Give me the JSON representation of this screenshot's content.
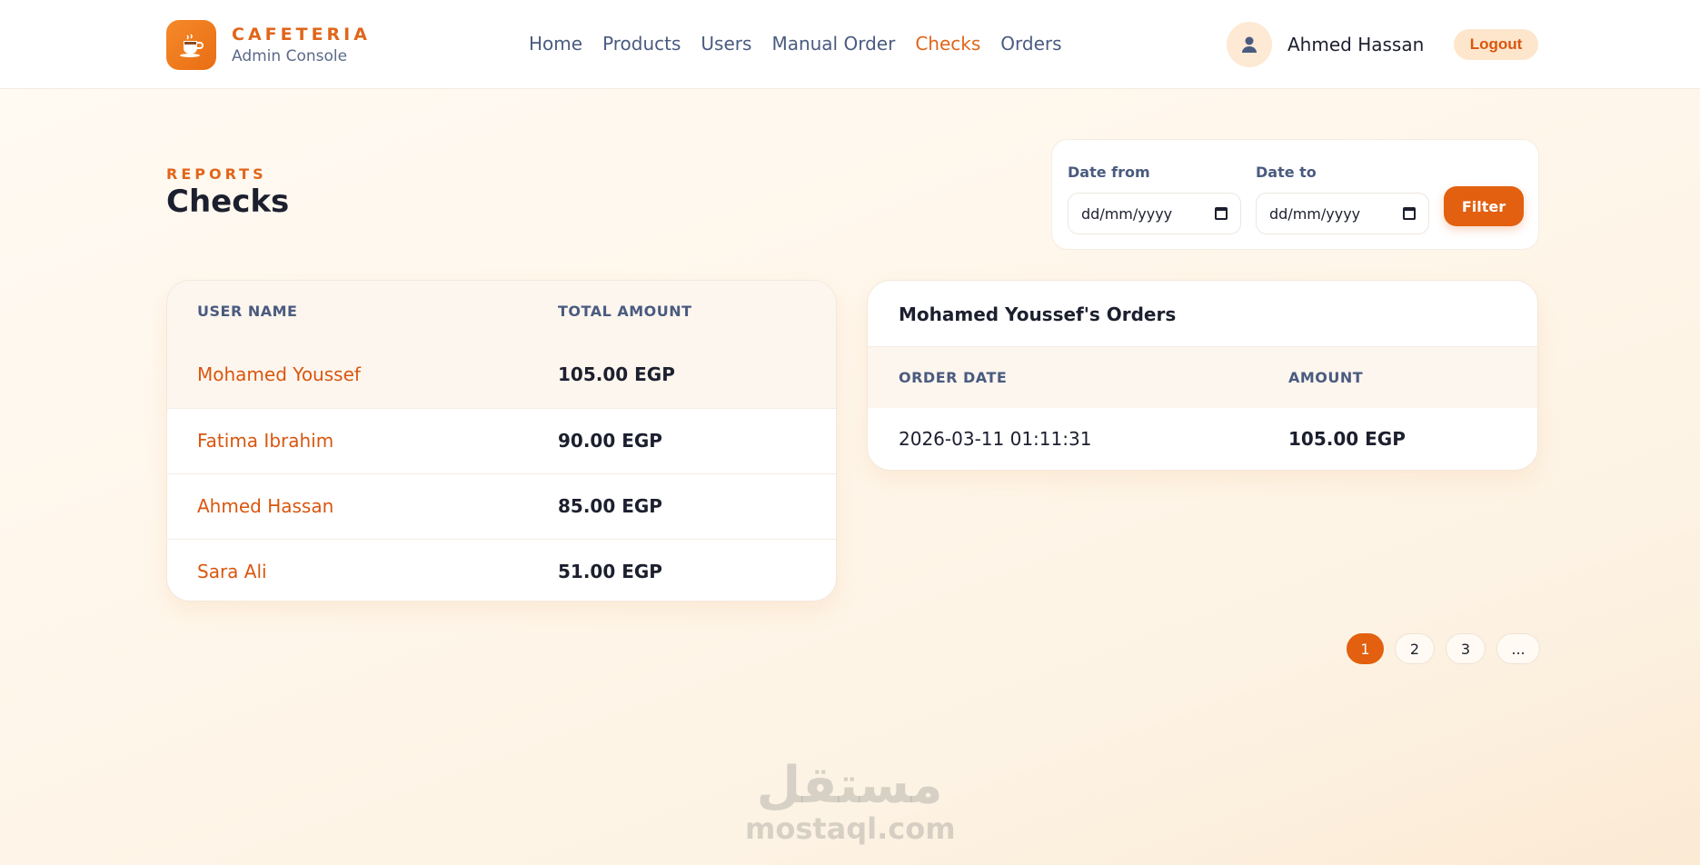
{
  "brand": {
    "name": "CAFETERIA",
    "subtitle": "Admin Console",
    "logo_icon": "coffee-cup-icon"
  },
  "nav": {
    "items": [
      {
        "label": "Home"
      },
      {
        "label": "Products"
      },
      {
        "label": "Users"
      },
      {
        "label": "Manual Order"
      },
      {
        "label": "Checks"
      },
      {
        "label": "Orders"
      }
    ],
    "active": "Checks"
  },
  "user": {
    "name": "Ahmed Hassan",
    "avatar_icon": "user-icon",
    "logout_label": "Logout"
  },
  "page": {
    "eyebrow": "REPORTS",
    "title": "Checks"
  },
  "filter": {
    "date_from_label": "Date from",
    "date_from_value": "dd/mm/yyyy",
    "date_to_label": "Date to",
    "date_to_value": "dd/mm/yyyy",
    "button_label": "Filter"
  },
  "users_table": {
    "headers": [
      "USER NAME",
      "TOTAL AMOUNT"
    ],
    "rows": [
      {
        "name": "Mohamed Youssef",
        "amount": "105.00 EGP"
      },
      {
        "name": "Fatima Ibrahim",
        "amount": "90.00 EGP"
      },
      {
        "name": "Ahmed Hassan",
        "amount": "85.00 EGP"
      },
      {
        "name": "Sara Ali",
        "amount": "51.00 EGP"
      }
    ],
    "selected_row": 0
  },
  "orders_panel": {
    "title": "Mohamed Youssef's Orders",
    "headers": [
      "ORDER DATE",
      "AMOUNT"
    ],
    "rows": [
      {
        "date": "2026-03-11 01:11:31",
        "amount": "105.00 EGP"
      }
    ]
  },
  "pagination": {
    "pages": [
      "1",
      "2",
      "3",
      "..."
    ],
    "current": "1"
  },
  "watermark": {
    "arabic": "مستقل",
    "latin": "mostaql.com"
  },
  "colors": {
    "accent": "#e0661a",
    "accent_button": "#e2600f",
    "nav_text": "#4a5b80",
    "text_dark": "#1c1f2e"
  }
}
